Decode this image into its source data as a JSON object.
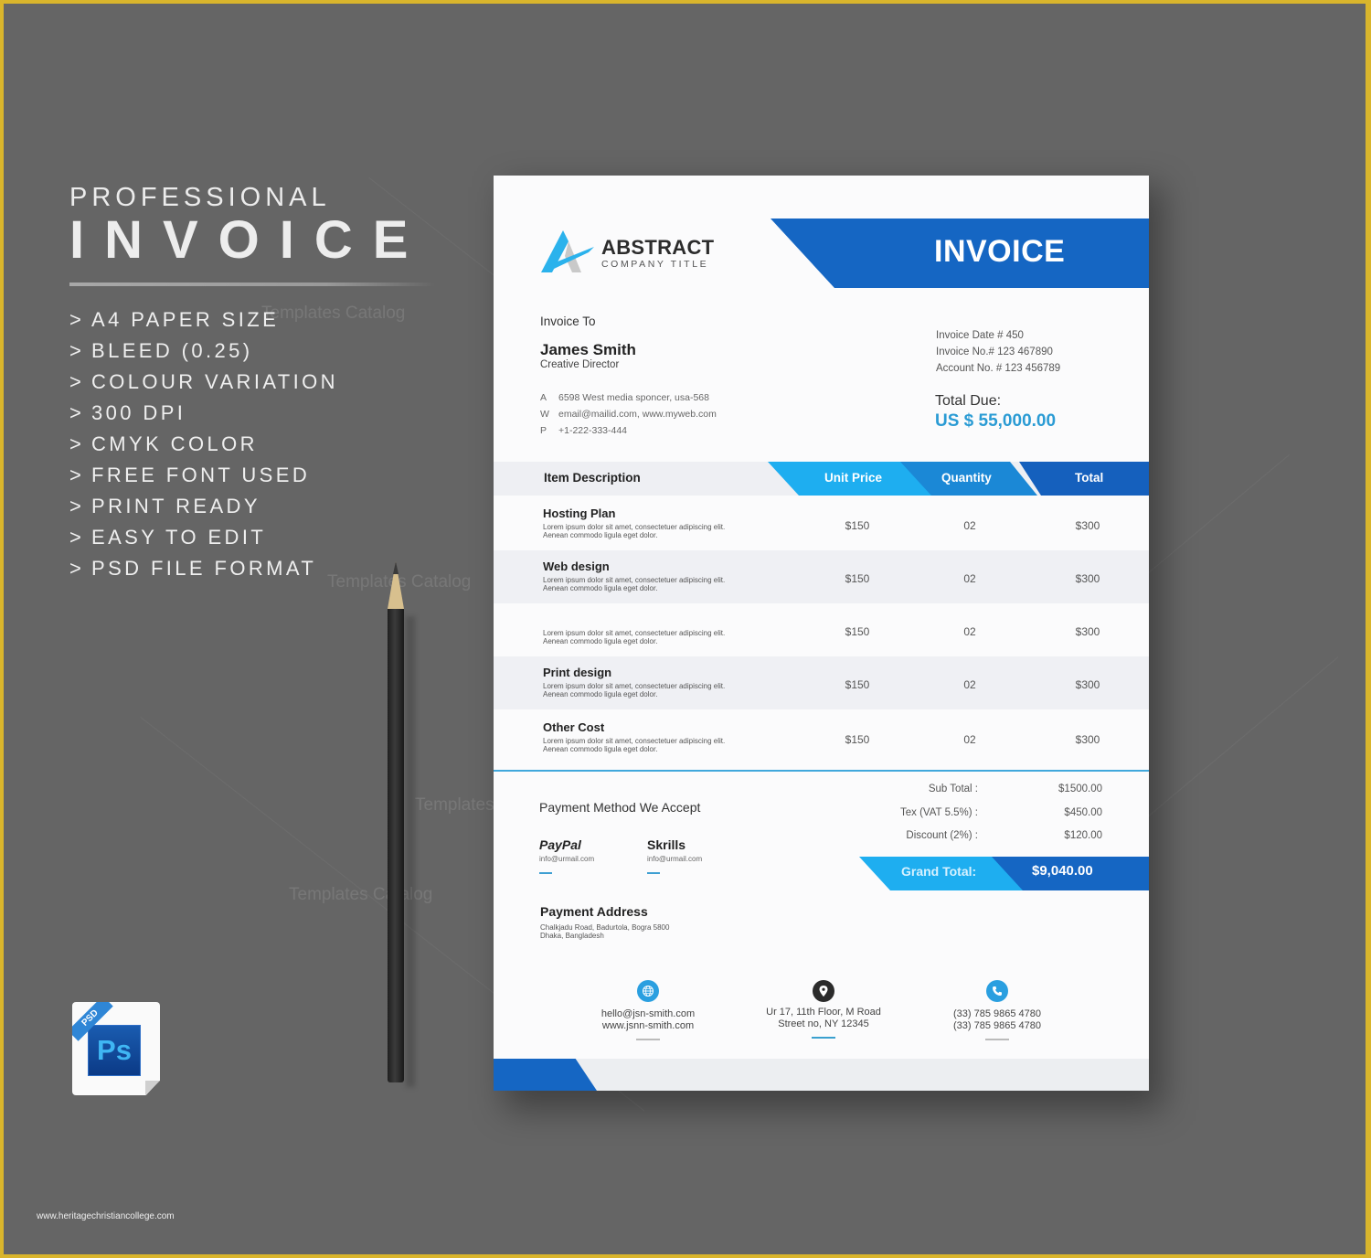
{
  "promo": {
    "kicker": "PROFESSIONAL",
    "title": "INVOICE",
    "features": [
      "A4 PAPER SIZE",
      "BLEED (0.25)",
      "COLOUR VARIATION",
      "300 DPI",
      "CMYK COLOR",
      "FREE FONT USED",
      "PRINT READY",
      "EASY TO EDIT",
      "PSD FILE FORMAT"
    ],
    "bullet": ">"
  },
  "watermarks": [
    "Templates Catalog",
    "Templates Catalog",
    "Templates",
    "Templates Catalog"
  ],
  "psd_badge": {
    "ribbon": "PSD",
    "label": "Ps"
  },
  "credit": "www.heritagechristiancollege.com",
  "colors": {
    "primary_blue": "#1566c3",
    "light_blue": "#1eaef0",
    "mid_blue": "#1b88d6",
    "accent_text": "#2a9bd4",
    "background": "#656565",
    "frame": "#d9b52c"
  },
  "invoice": {
    "company": {
      "name": "ABSTRACT",
      "subtitle": "COMPANY TITLE",
      "logo_icon": "abstract-a-logo"
    },
    "title": "INVOICE",
    "bill_to": {
      "label": "Invoice To",
      "name": "James Smith",
      "role": "Creative Director",
      "contacts": [
        {
          "key": "A",
          "value": "6598 West media sponcer, usa-568"
        },
        {
          "key": "W",
          "value": "email@mailid.com, www.myweb.com"
        },
        {
          "key": "P",
          "value": "+1-222-333-444"
        }
      ]
    },
    "meta": {
      "invoice_date": "Invoice Date # 450",
      "invoice_no": "Invoice No.# 123 467890",
      "account_no": "Account No. # 123 456789"
    },
    "total_due": {
      "label": "Total Due:",
      "amount": "US $ 55,000.00"
    },
    "table": {
      "headers": {
        "description": "Item Description",
        "unit_price": "Unit Price",
        "quantity": "Quantity",
        "total": "Total"
      },
      "rows": [
        {
          "title": "Hosting Plan",
          "desc1": "Lorem ipsum dolor sit amet, consectetuer adipiscing elit.",
          "desc2": "Aenean commodo ligula eget dolor.",
          "unit_price": "$150",
          "quantity": "02",
          "total": "$300"
        },
        {
          "title": "Web design",
          "desc1": "Lorem ipsum dolor sit amet, consectetuer adipiscing elit.",
          "desc2": "Aenean commodo ligula eget dolor.",
          "unit_price": "$150",
          "quantity": "02",
          "total": "$300"
        },
        {
          "title": "",
          "desc1": "Lorem ipsum dolor sit amet, consectetuer adipiscing elit.",
          "desc2": "Aenean commodo ligula eget dolor.",
          "unit_price": "$150",
          "quantity": "02",
          "total": "$300"
        },
        {
          "title": "Print design",
          "desc1": "Lorem ipsum dolor sit amet, consectetuer adipiscing elit.",
          "desc2": "Aenean commodo ligula eget dolor.",
          "unit_price": "$150",
          "quantity": "02",
          "total": "$300"
        },
        {
          "title": "Other Cost",
          "desc1": "Lorem ipsum dolor sit amet, consectetuer adipiscing elit.",
          "desc2": "Aenean commodo ligula eget dolor.",
          "unit_price": "$150",
          "quantity": "02",
          "total": "$300"
        }
      ]
    },
    "payment_methods": {
      "title": "Payment Method We Accept",
      "methods": [
        {
          "name": "PayPal",
          "email": "info@urmail.com"
        },
        {
          "name": "Skrills",
          "email": "info@urmail.com"
        }
      ]
    },
    "payment_address": {
      "title": "Payment Address",
      "line1": "Chalkjadu Road, Badurtola, Bogra 5800",
      "line2": "Dhaka, Bangladesh"
    },
    "summary": {
      "subtotal_label": "Sub Total :",
      "subtotal": "$1500.00",
      "tax_label": "Tex (VAT 5.5%) :",
      "tax": "$450.00",
      "discount_label": "Discount (2%) :",
      "discount": "$120.00",
      "grand_total_label": "Grand Total:",
      "grand_total": "$9,040.00"
    },
    "footer": [
      {
        "icon": "globe-icon",
        "line1": "hello@jsn-smith.com",
        "line2": "www.jsnn-smith.com"
      },
      {
        "icon": "map-pin-icon",
        "line1": "Ur 17, 11th Floor, M Road",
        "line2": "Street no, NY 12345"
      },
      {
        "icon": "phone-icon",
        "line1": "(33) 785 9865 4780",
        "line2": "(33) 785 9865 4780"
      }
    ]
  }
}
